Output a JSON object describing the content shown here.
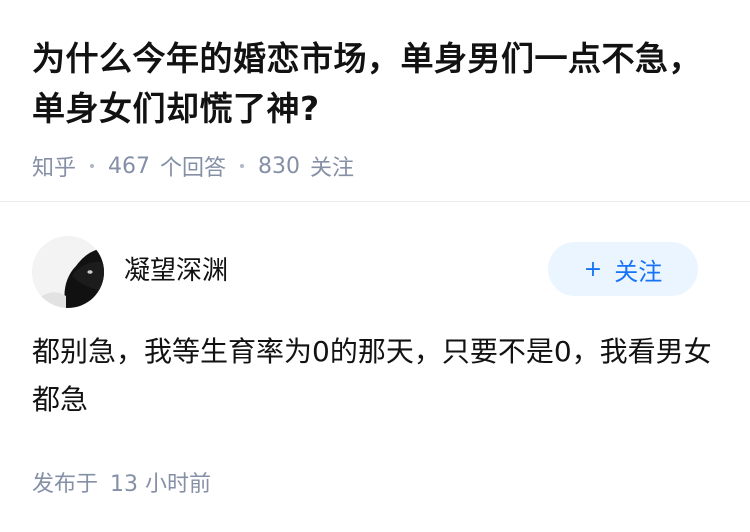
{
  "question": {
    "title": "为什么今年的婚恋市场，单身男们一点不急，单身女们却慌了神?",
    "source": "知乎",
    "answer_count": "467",
    "answer_label": "个回答",
    "follower_count": "830",
    "follower_label": "关注"
  },
  "answer": {
    "author_name": "凝望深渊",
    "follow_button_label": "关注",
    "follow_button_icon": "plus-icon",
    "content": "都别急，我等生育率为0的那天，只要不是0，我看男女都急",
    "footer_prefix": "发布于",
    "footer_time": "13 小时前"
  },
  "colors": {
    "text_primary": "#121212",
    "text_secondary": "#8590a6",
    "accent_blue": "#1772f6",
    "button_bg": "#ebf5ff"
  }
}
